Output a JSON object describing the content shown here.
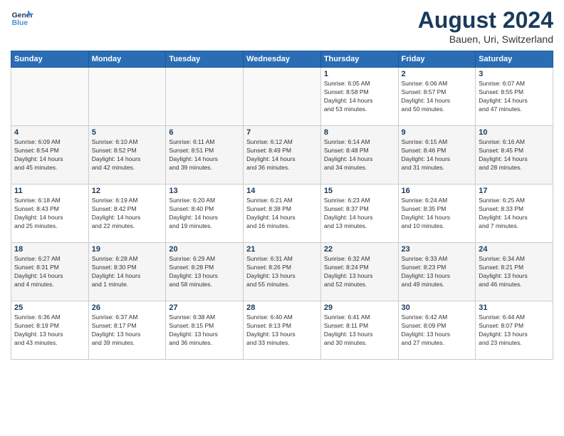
{
  "header": {
    "logo_line1": "General",
    "logo_line2": "Blue",
    "month_year": "August 2024",
    "location": "Bauen, Uri, Switzerland"
  },
  "days_of_week": [
    "Sunday",
    "Monday",
    "Tuesday",
    "Wednesday",
    "Thursday",
    "Friday",
    "Saturday"
  ],
  "weeks": [
    [
      {
        "day": "",
        "info": ""
      },
      {
        "day": "",
        "info": ""
      },
      {
        "day": "",
        "info": ""
      },
      {
        "day": "",
        "info": ""
      },
      {
        "day": "1",
        "info": "Sunrise: 6:05 AM\nSunset: 8:58 PM\nDaylight: 14 hours\nand 53 minutes."
      },
      {
        "day": "2",
        "info": "Sunrise: 6:06 AM\nSunset: 8:57 PM\nDaylight: 14 hours\nand 50 minutes."
      },
      {
        "day": "3",
        "info": "Sunrise: 6:07 AM\nSunset: 8:55 PM\nDaylight: 14 hours\nand 47 minutes."
      }
    ],
    [
      {
        "day": "4",
        "info": "Sunrise: 6:09 AM\nSunset: 8:54 PM\nDaylight: 14 hours\nand 45 minutes."
      },
      {
        "day": "5",
        "info": "Sunrise: 6:10 AM\nSunset: 8:52 PM\nDaylight: 14 hours\nand 42 minutes."
      },
      {
        "day": "6",
        "info": "Sunrise: 6:11 AM\nSunset: 8:51 PM\nDaylight: 14 hours\nand 39 minutes."
      },
      {
        "day": "7",
        "info": "Sunrise: 6:12 AM\nSunset: 8:49 PM\nDaylight: 14 hours\nand 36 minutes."
      },
      {
        "day": "8",
        "info": "Sunrise: 6:14 AM\nSunset: 8:48 PM\nDaylight: 14 hours\nand 34 minutes."
      },
      {
        "day": "9",
        "info": "Sunrise: 6:15 AM\nSunset: 8:46 PM\nDaylight: 14 hours\nand 31 minutes."
      },
      {
        "day": "10",
        "info": "Sunrise: 6:16 AM\nSunset: 8:45 PM\nDaylight: 14 hours\nand 28 minutes."
      }
    ],
    [
      {
        "day": "11",
        "info": "Sunrise: 6:18 AM\nSunset: 8:43 PM\nDaylight: 14 hours\nand 25 minutes."
      },
      {
        "day": "12",
        "info": "Sunrise: 6:19 AM\nSunset: 8:42 PM\nDaylight: 14 hours\nand 22 minutes."
      },
      {
        "day": "13",
        "info": "Sunrise: 6:20 AM\nSunset: 8:40 PM\nDaylight: 14 hours\nand 19 minutes."
      },
      {
        "day": "14",
        "info": "Sunrise: 6:21 AM\nSunset: 8:38 PM\nDaylight: 14 hours\nand 16 minutes."
      },
      {
        "day": "15",
        "info": "Sunrise: 6:23 AM\nSunset: 8:37 PM\nDaylight: 14 hours\nand 13 minutes."
      },
      {
        "day": "16",
        "info": "Sunrise: 6:24 AM\nSunset: 8:35 PM\nDaylight: 14 hours\nand 10 minutes."
      },
      {
        "day": "17",
        "info": "Sunrise: 6:25 AM\nSunset: 8:33 PM\nDaylight: 14 hours\nand 7 minutes."
      }
    ],
    [
      {
        "day": "18",
        "info": "Sunrise: 6:27 AM\nSunset: 8:31 PM\nDaylight: 14 hours\nand 4 minutes."
      },
      {
        "day": "19",
        "info": "Sunrise: 6:28 AM\nSunset: 8:30 PM\nDaylight: 14 hours\nand 1 minute."
      },
      {
        "day": "20",
        "info": "Sunrise: 6:29 AM\nSunset: 8:28 PM\nDaylight: 13 hours\nand 58 minutes."
      },
      {
        "day": "21",
        "info": "Sunrise: 6:31 AM\nSunset: 8:26 PM\nDaylight: 13 hours\nand 55 minutes."
      },
      {
        "day": "22",
        "info": "Sunrise: 6:32 AM\nSunset: 8:24 PM\nDaylight: 13 hours\nand 52 minutes."
      },
      {
        "day": "23",
        "info": "Sunrise: 6:33 AM\nSunset: 8:23 PM\nDaylight: 13 hours\nand 49 minutes."
      },
      {
        "day": "24",
        "info": "Sunrise: 6:34 AM\nSunset: 8:21 PM\nDaylight: 13 hours\nand 46 minutes."
      }
    ],
    [
      {
        "day": "25",
        "info": "Sunrise: 6:36 AM\nSunset: 8:19 PM\nDaylight: 13 hours\nand 43 minutes."
      },
      {
        "day": "26",
        "info": "Sunrise: 6:37 AM\nSunset: 8:17 PM\nDaylight: 13 hours\nand 39 minutes."
      },
      {
        "day": "27",
        "info": "Sunrise: 6:38 AM\nSunset: 8:15 PM\nDaylight: 13 hours\nand 36 minutes."
      },
      {
        "day": "28",
        "info": "Sunrise: 6:40 AM\nSunset: 8:13 PM\nDaylight: 13 hours\nand 33 minutes."
      },
      {
        "day": "29",
        "info": "Sunrise: 6:41 AM\nSunset: 8:11 PM\nDaylight: 13 hours\nand 30 minutes."
      },
      {
        "day": "30",
        "info": "Sunrise: 6:42 AM\nSunset: 8:09 PM\nDaylight: 13 hours\nand 27 minutes."
      },
      {
        "day": "31",
        "info": "Sunrise: 6:44 AM\nSunset: 8:07 PM\nDaylight: 13 hours\nand 23 minutes."
      }
    ]
  ]
}
